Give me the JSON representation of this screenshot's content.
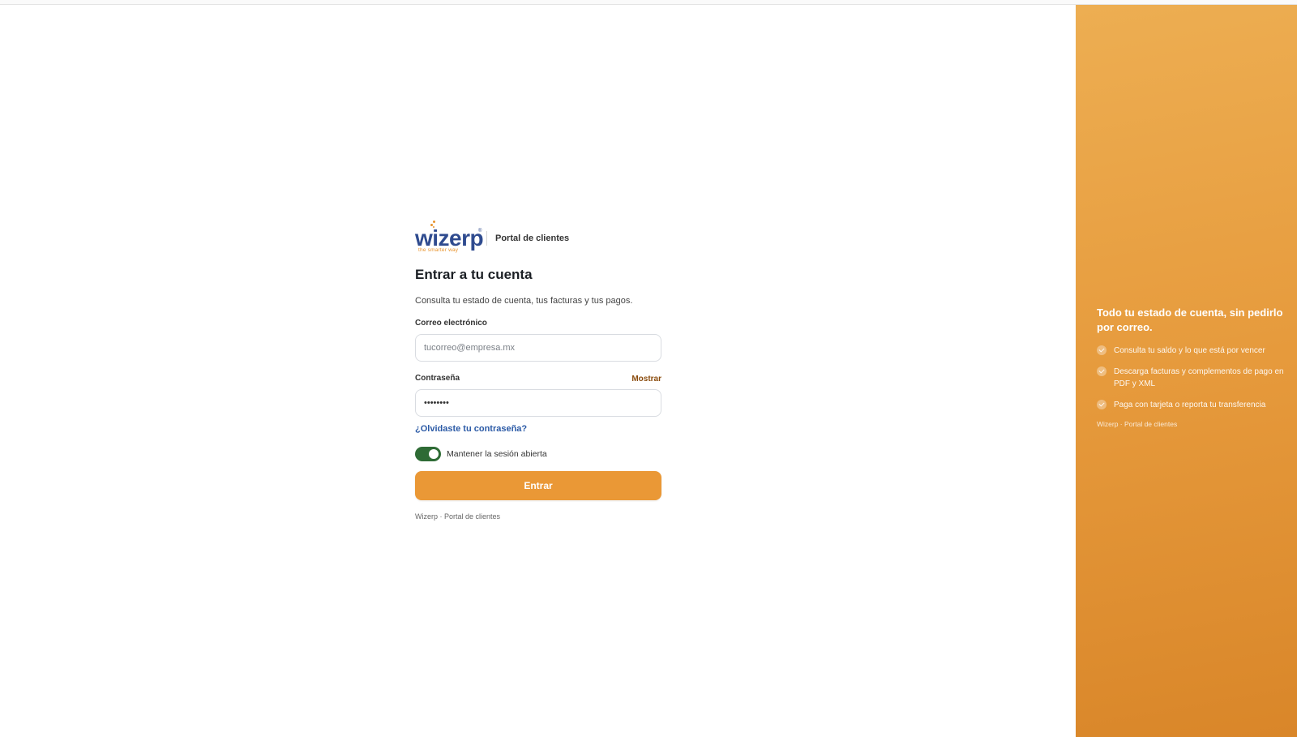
{
  "brand": {
    "logo_text": "wizerp",
    "logo_tagline": "the smarter way",
    "logo_mark": "®",
    "portal_label": "Portal de clientes"
  },
  "login": {
    "title": "Entrar a tu cuenta",
    "subtitle": "Consulta tu estado de cuenta, tus facturas y tus pagos.",
    "email_label": "Correo electrónico",
    "email_placeholder": "tucorreo@empresa.mx",
    "email_value": "",
    "password_label": "Contraseña",
    "password_toggle": "Mostrar",
    "password_value": "••••••••",
    "forgot_link": "¿Olvidaste tu contraseña?",
    "remember_label": "Mantener la sesión abierta",
    "remember_checked": true,
    "submit_label": "Entrar",
    "footer": "Wizerp · Portal de clientes"
  },
  "panel": {
    "title": "Todo tu estado de cuenta, sin pedirlo por correo.",
    "bullets": [
      {
        "text": "Consulta tu saldo y lo que está por vencer",
        "icon": "check-circle-icon"
      },
      {
        "text": "Descarga facturas y complementos de pago en PDF y XML",
        "icon": "check-circle-icon"
      },
      {
        "text": "Paga con tarjeta o reporta tu transferencia",
        "icon": "check-circle-icon"
      }
    ],
    "footer": "Wizerp · Portal de clientes"
  },
  "colors": {
    "accent": "#ea9836",
    "brand_blue": "#2f4b8f",
    "toggle_on": "#2e6b35",
    "link": "#2b5aa6",
    "show_link": "#8a4b0c"
  }
}
